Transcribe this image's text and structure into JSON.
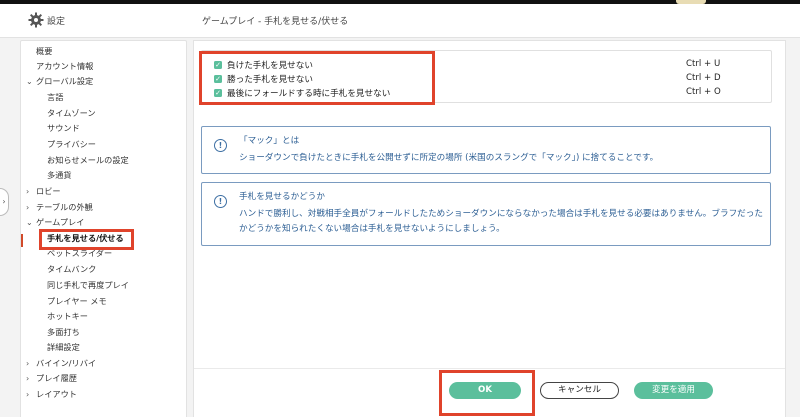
{
  "header": {
    "settings_title": "設定",
    "page_title": "ゲームプレイ - 手札を見せる/伏せる"
  },
  "sidebar": {
    "items": [
      {
        "label": "概要",
        "indent": 0,
        "expander": ""
      },
      {
        "label": "アカウント情報",
        "indent": 0,
        "expander": ""
      },
      {
        "label": "グローバル設定",
        "indent": 0,
        "expander": "⌄"
      },
      {
        "label": "言語",
        "indent": 1,
        "expander": ""
      },
      {
        "label": "タイムゾーン",
        "indent": 1,
        "expander": ""
      },
      {
        "label": "サウンド",
        "indent": 1,
        "expander": ""
      },
      {
        "label": "プライバシー",
        "indent": 1,
        "expander": ""
      },
      {
        "label": "お知らせメールの設定",
        "indent": 1,
        "expander": ""
      },
      {
        "label": "多通貨",
        "indent": 1,
        "expander": ""
      },
      {
        "label": "ロビー",
        "indent": 0,
        "expander": "›"
      },
      {
        "label": "テーブルの外観",
        "indent": 0,
        "expander": "›"
      },
      {
        "label": "ゲームプレイ",
        "indent": 0,
        "expander": "⌄"
      },
      {
        "label": "手札を見せる/伏せる",
        "indent": 1,
        "expander": "",
        "active": true
      },
      {
        "label": "ベットスライダー",
        "indent": 1,
        "expander": ""
      },
      {
        "label": "タイムバンク",
        "indent": 1,
        "expander": ""
      },
      {
        "label": "同じ手札で再度プレイ",
        "indent": 1,
        "expander": ""
      },
      {
        "label": "プレイヤー メモ",
        "indent": 1,
        "expander": ""
      },
      {
        "label": "ホットキー",
        "indent": 1,
        "expander": ""
      },
      {
        "label": "多面打ち",
        "indent": 1,
        "expander": ""
      },
      {
        "label": "詳細設定",
        "indent": 1,
        "expander": ""
      },
      {
        "label": "バイイン/リバイ",
        "indent": 0,
        "expander": "›"
      },
      {
        "label": "プレイ履歴",
        "indent": 0,
        "expander": "›"
      },
      {
        "label": "レイアウト",
        "indent": 0,
        "expander": "›"
      }
    ]
  },
  "options": [
    {
      "label": "負けた手札を見せない",
      "shortcut": "Ctrl + U",
      "checked": true
    },
    {
      "label": "勝った手札を見せない",
      "shortcut": "Ctrl + D",
      "checked": true
    },
    {
      "label": "最後にフォールドする時に手札を見せない",
      "shortcut": "Ctrl + O",
      "checked": true
    }
  ],
  "info": [
    {
      "title": "「マック」とは",
      "body": "ショーダウンで負けたときに手札を公開せずに所定の場所 (米国のスラングで「マック」) に捨てることです。"
    },
    {
      "title": "手札を見せるかどうか",
      "body": "ハンドで勝利し、対戦相手全員がフォールドしたためショーダウンにならなかった場合は手札を見せる必要はありません。ブラフだったかどうかを知られたくない場合は手札を見せないようにしましょう。"
    }
  ],
  "buttons": {
    "ok": "OK",
    "cancel": "キャンセル",
    "apply": "変更を適用"
  },
  "icons": {
    "settings": "gear-icon",
    "info": "info-icon",
    "check": "check-icon"
  },
  "colors": {
    "accent": "#5bbf9c",
    "info": "#2d5f94",
    "highlight": "#e0432b"
  }
}
